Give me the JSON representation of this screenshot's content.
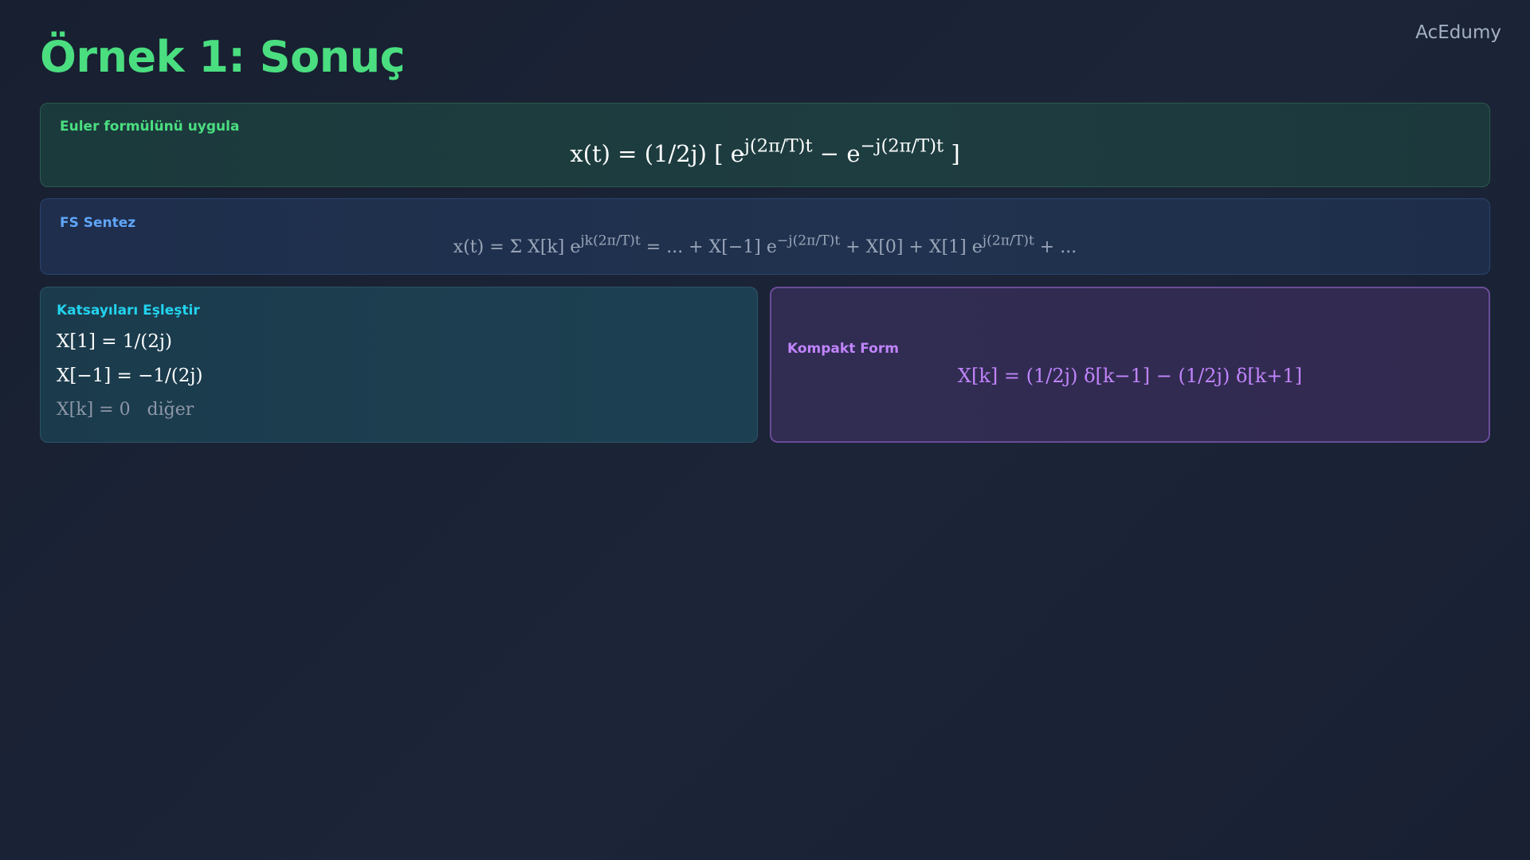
{
  "brand": "AcEdumy",
  "title": "Örnek 1: Sonuç",
  "euler": {
    "label": "Euler formülünü uygula",
    "eq_a": "x(t) = (1/2j) [ e",
    "exp_a": "j(2π/T)t",
    "eq_b": " − e",
    "exp_b": "−j(2π/T)t",
    "eq_c": " ]"
  },
  "fs": {
    "label": "FS Sentez",
    "p1": "x(t) = Σ X[k] e",
    "e1": "jk(2π/T)t",
    "p2": " = ... + X[−1] e",
    "e2": "−j(2π/T)t",
    "p3": " + X[0] + X[1] e",
    "e3": "j(2π/T)t",
    "p4": " + ..."
  },
  "coefficients": {
    "label": "Katsayıları Eşleştir",
    "line1": "X[1] = 1/(2j)",
    "line2": "X[−1] = −1/(2j)",
    "line3": "X[k] = 0   diğer"
  },
  "compact": {
    "label": "Kompakt Form",
    "equation": "X[k] = (1/2j) δ[k−1] − (1/2j) δ[k+1]"
  },
  "colors": {
    "title": "#4ade80",
    "euler_label": "#4ade80",
    "fs_label": "#60a5fa",
    "coef_label": "#22d3ee",
    "compact_label": "#c084fc"
  }
}
